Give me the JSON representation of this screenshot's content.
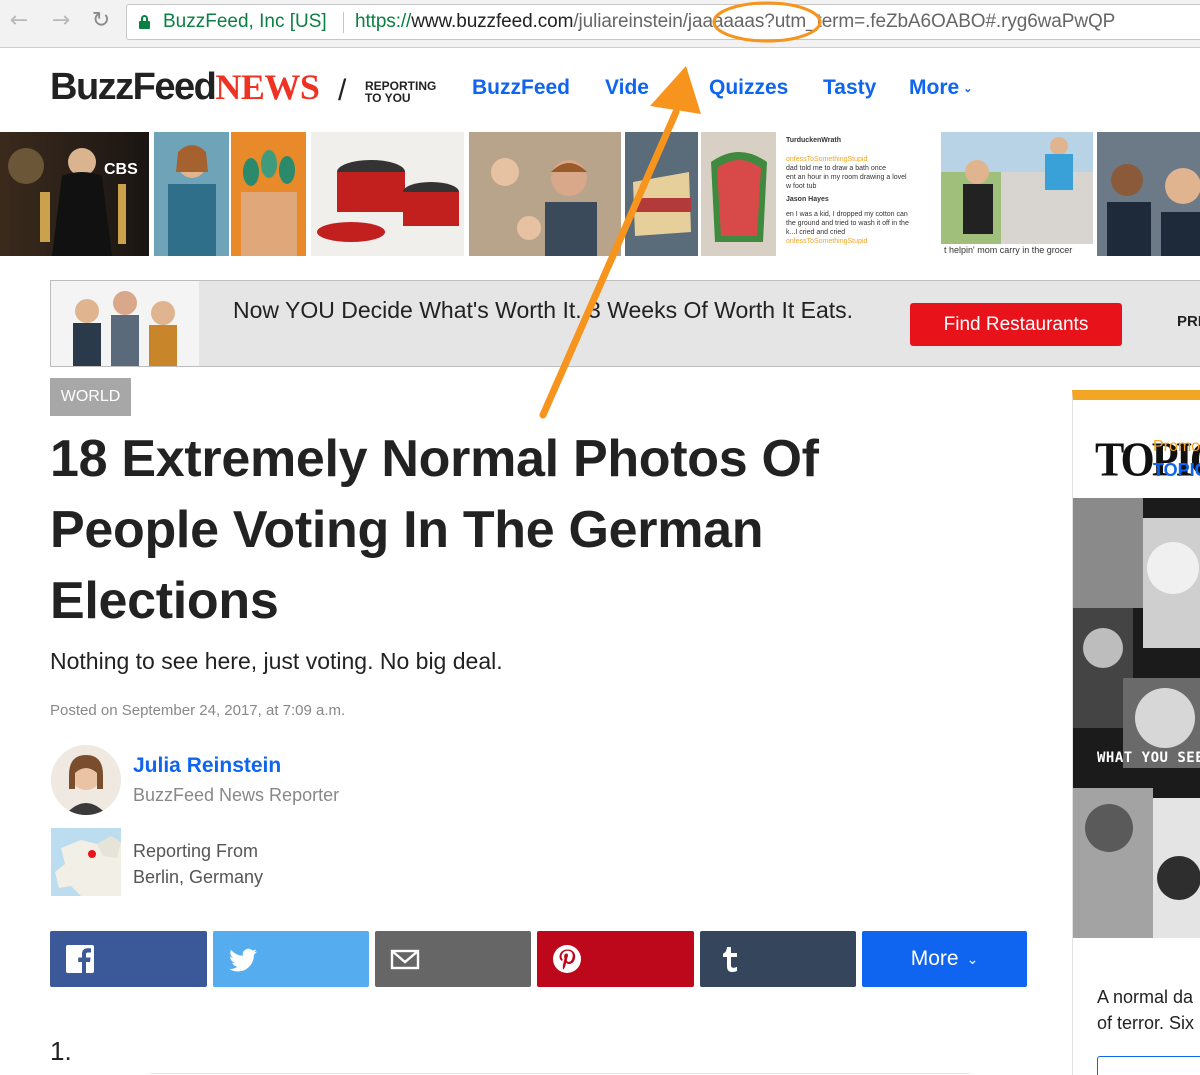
{
  "browser": {
    "ssl_org": "BuzzFeed, Inc [US]",
    "url_scheme": "https://",
    "url_host": "www.buzzfeed.com",
    "url_path": "/juliareinstein/jaaaaaas?utm_term=.feZbA6OABO#.ryg6waPwQP",
    "nav_back_icon": "back-arrow-icon",
    "nav_forward_icon": "forward-arrow-icon",
    "reload_icon": "reload-icon"
  },
  "header": {
    "logo_buzzfeed": "BuzzFeed",
    "logo_news": "NEWS",
    "tagline_line1": "REPORTING",
    "tagline_line2": "TO YOU",
    "nav": [
      {
        "label": "BuzzFeed"
      },
      {
        "label": "Vide"
      },
      {
        "label": "Quizzes"
      },
      {
        "label": "Tasty"
      },
      {
        "label": "More"
      }
    ]
  },
  "strip": {
    "tweet_handle": "TurduckenWrath",
    "tweet_tag1": "onfessToSomethingStupid",
    "tweet_line1": "dad told me to draw a bath once",
    "tweet_line2": "ent an hour in my room drawing a lovel",
    "tweet_line3": "w foot tub",
    "tweet_author": "Jason Hayes",
    "tweet_line4": "en I was a kid, I dropped my cotton can",
    "tweet_line5": "the ground and tried to wash it off in the",
    "tweet_line6": "k...I cried and cried",
    "tweet_tag2": "onfessToSomethingStupid",
    "stairs_caption": "t helpin' mom carry in the grocer",
    "cbs_label": "CBS"
  },
  "ad": {
    "text": "Now YOU Decide What's Worth It. 3 Weeks Of Worth It Eats.",
    "button": "Find Restaurants",
    "cut_label": "PRE"
  },
  "article": {
    "section": "WORLD",
    "headline": "18 Extremely Normal Photos Of People Voting In The German Elections",
    "dek": "Nothing to see here, just voting. No big deal.",
    "posted": "Posted on September 24, 2017, at 7:09 a.m.",
    "author_name": "Julia Reinstein",
    "author_title": "BuzzFeed News Reporter",
    "reporting_from_label": "Reporting From",
    "reporting_from_place": "Berlin, Germany",
    "share_more": "More",
    "list_number": "1."
  },
  "promo": {
    "logo": "TOPIC",
    "promoted_by": "Promo",
    "topic_label": "TOPIC",
    "image_caption": "WHAT YOU SEE",
    "text_line1": "A normal da",
    "text_line2": "of terror. Six"
  },
  "colors": {
    "facebook": "#3b5998",
    "twitter": "#55acee",
    "email": "#666666",
    "pinterest": "#bd081c",
    "tumblr": "#35465c",
    "more": "#0f65ef",
    "annotation": "#f7941d",
    "buzzfeed_blue": "#0f65ef",
    "news_red": "#ee3322"
  }
}
